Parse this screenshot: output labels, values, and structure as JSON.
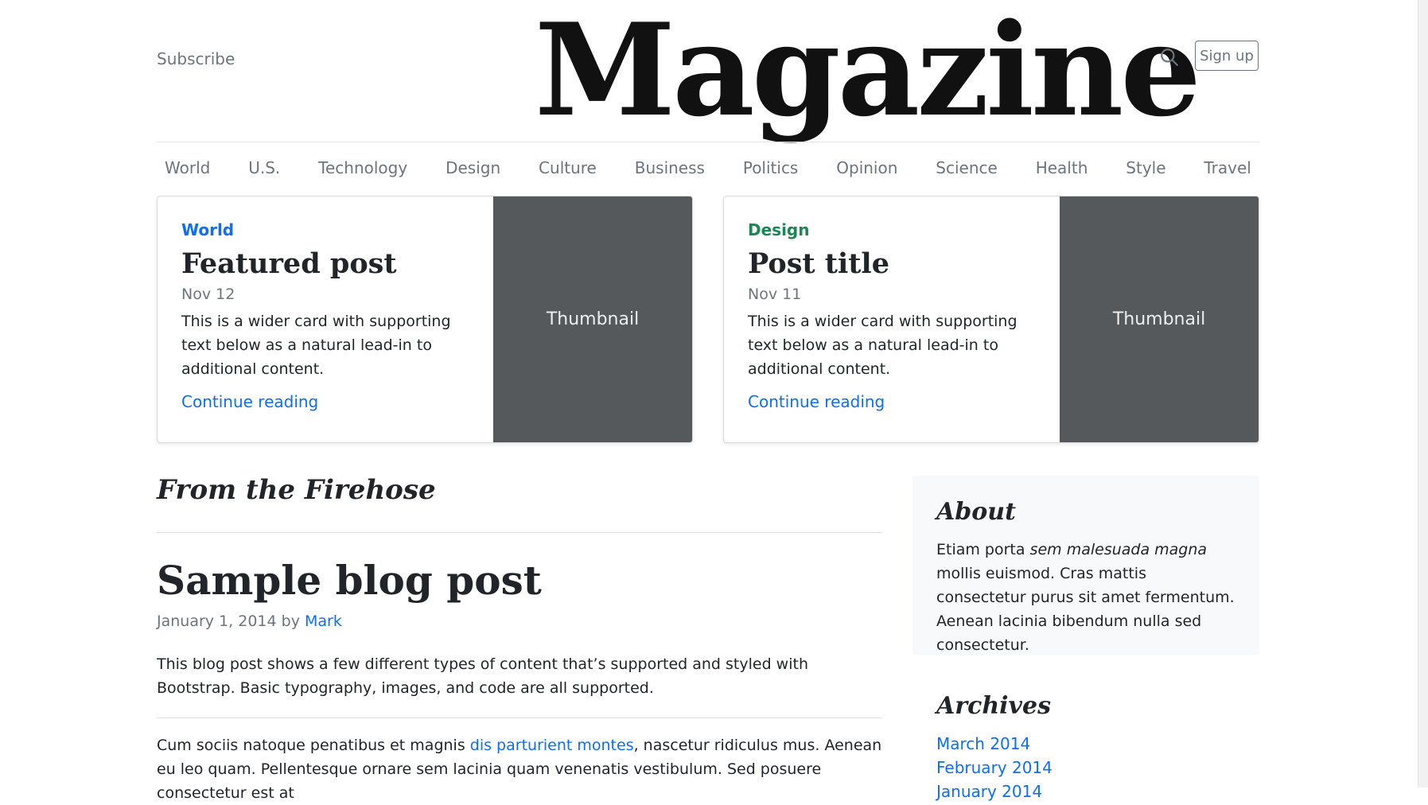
{
  "header": {
    "subscribe": "Subscribe",
    "brand": "Magazine",
    "signup": "Sign up",
    "search_icon": "search-icon"
  },
  "nav": [
    "World",
    "U.S.",
    "Technology",
    "Design",
    "Culture",
    "Business",
    "Politics",
    "Opinion",
    "Science",
    "Health",
    "Style",
    "Travel"
  ],
  "featured": [
    {
      "category": "World",
      "category_color": "#0d6efd",
      "title": "Featured post",
      "date": "Nov 12",
      "text": "This is a wider card with supporting text below as a natural lead-in to additional content.",
      "link": "Continue reading",
      "thumbnail": "Thumbnail"
    },
    {
      "category": "Design",
      "category_color": "#198754",
      "title": "Post title",
      "date": "Nov 11",
      "text": "This is a wider card with supporting text below as a natural lead-in to additional content.",
      "link": "Continue reading",
      "thumbnail": "Thumbnail"
    }
  ],
  "main": {
    "section_title": "From the Firehose",
    "post": {
      "title": "Sample blog post",
      "date": "January 1, 2014 by",
      "author": "Mark",
      "intro": "This blog post shows a few different types of content that’s supported and styled with Bootstrap. Basic typography, images, and code are all supported.",
      "body_before": "Cum sociis natoque penatibus et magnis ",
      "body_link": "dis parturient montes",
      "body_after": ", nascetur ridiculus mus. Aenean eu leo quam. Pellentesque ornare sem lacinia quam venenatis vestibulum. Sed posuere consectetur est at"
    }
  },
  "sidebar": {
    "about_title": "About",
    "about_before": "Etiam porta ",
    "about_em": "sem malesuada magna",
    "about_after": " mollis euismod. Cras mattis consectetur purus sit amet fermentum. Aenean lacinia bibendum nulla sed consectetur.",
    "archives_title": "Archives",
    "archives": [
      "March 2014",
      "February 2014",
      "January 2014"
    ]
  },
  "colors": {
    "accent": "#0d6efd",
    "design": "#198754",
    "thumbnail_bg": "#55595c"
  }
}
